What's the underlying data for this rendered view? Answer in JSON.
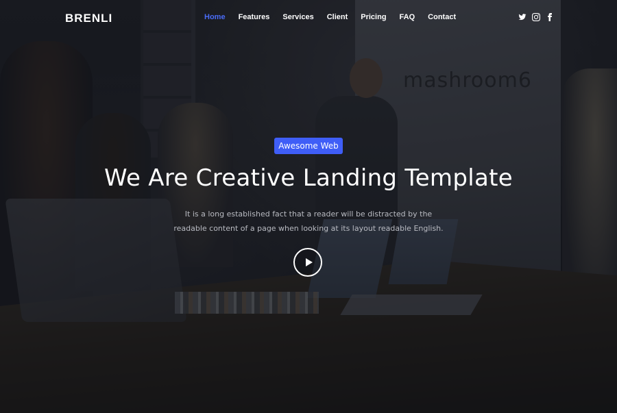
{
  "brand": {
    "name": "BRENLI"
  },
  "nav": {
    "items": [
      {
        "label": "Home",
        "active": true
      },
      {
        "label": "Features",
        "active": false
      },
      {
        "label": "Services",
        "active": false
      },
      {
        "label": "Client",
        "active": false
      },
      {
        "label": "Pricing",
        "active": false
      },
      {
        "label": "FAQ",
        "active": false
      },
      {
        "label": "Contact",
        "active": false
      }
    ]
  },
  "social": {
    "icons": [
      "twitter-icon",
      "instagram-icon",
      "facebook-icon"
    ]
  },
  "hero": {
    "background_logo_text": "mashroom6",
    "badge": "Awesome Web",
    "title": "We Are Creative Landing Template",
    "description_line1": "It is a long established fact that a reader will be distracted by the",
    "description_line2": "readable content of a page when looking at its layout readable English.",
    "play_icon": "play-icon"
  },
  "colors": {
    "accent": "#3f5ef7",
    "nav_active": "#4a6cf7",
    "text_primary": "#ffffff",
    "text_muted": "#b9bbc2"
  }
}
